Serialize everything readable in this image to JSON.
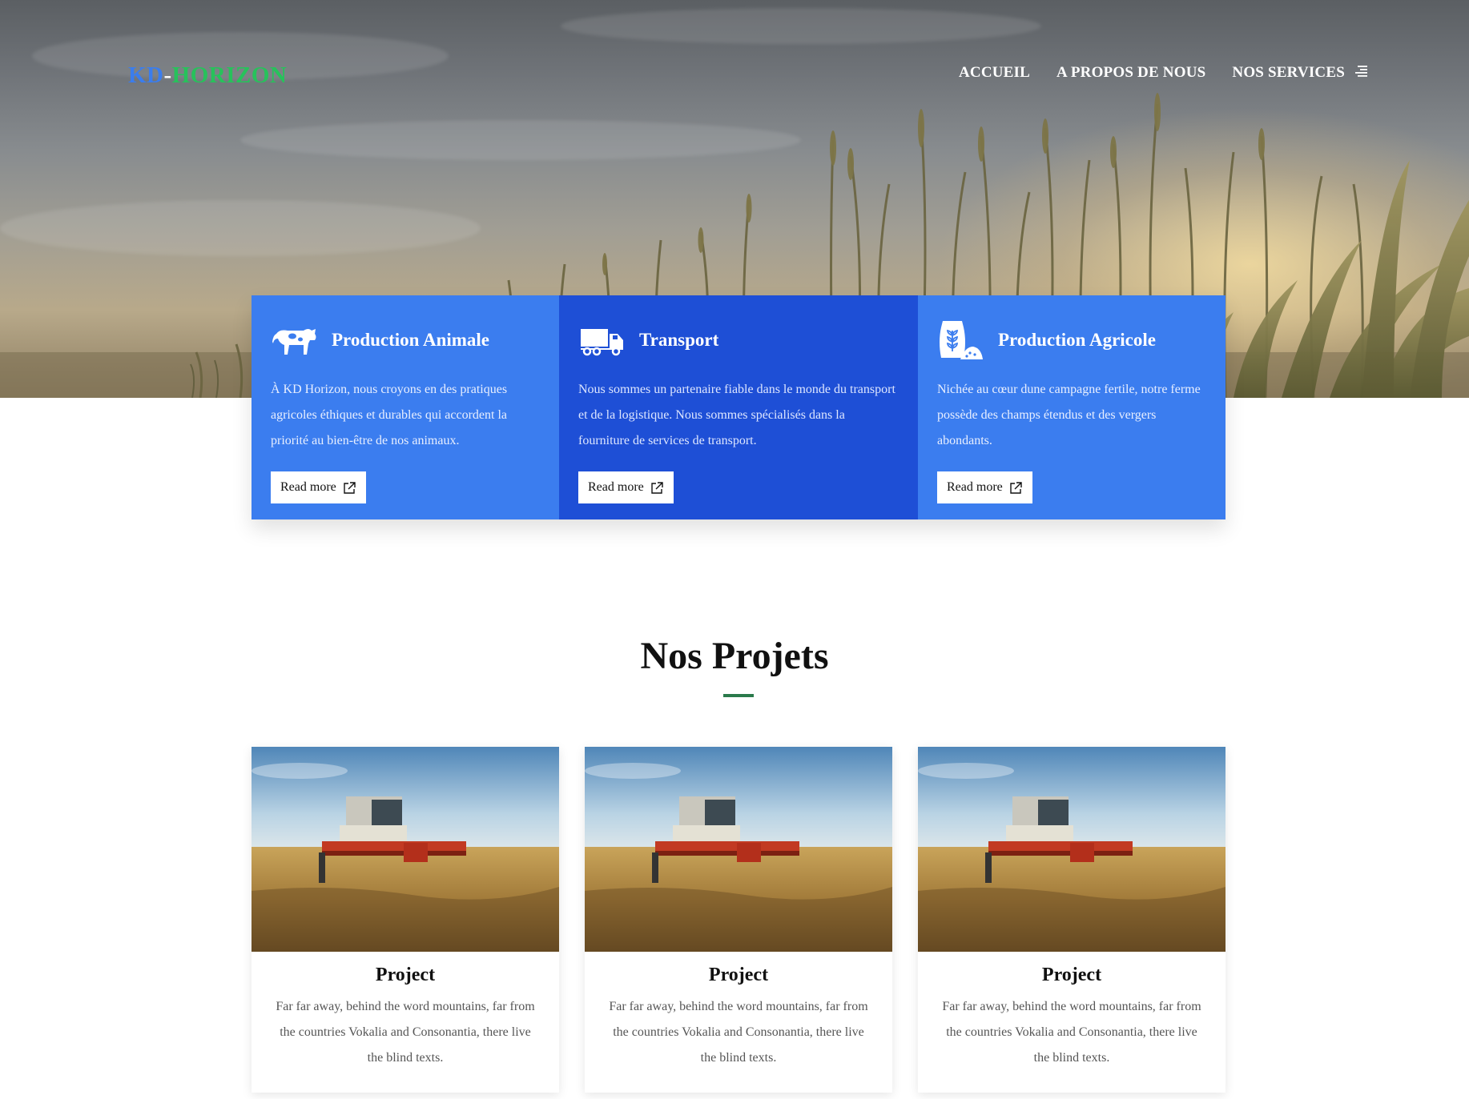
{
  "brand": {
    "part1": "KD",
    "sep": "-",
    "part2": "HORIZON",
    "color1": "#3b7ded",
    "color2": "#27c25b"
  },
  "nav": {
    "items": [
      {
        "label": "ACCUEIL"
      },
      {
        "label": "A PROPOS DE NOUS"
      },
      {
        "label": "NOS SERVICES"
      }
    ],
    "menu_icon": "menu-icon"
  },
  "services": [
    {
      "icon": "cow-icon",
      "title": "Production Animale",
      "text": "À KD Horizon, nous croyons en des pratiques agricoles éthiques et durables qui accordent la priorité au bien-être de nos animaux.",
      "button": "Read more"
    },
    {
      "icon": "truck-icon",
      "title": "Transport",
      "text": "Nous sommes un partenaire fiable dans le monde du transport et de la logistique. Nous sommes spécialisés dans la fourniture de services de transport.",
      "button": "Read more"
    },
    {
      "icon": "grain-sack-icon",
      "title": "Production Agricole",
      "text": "Nichée au cœur dune campagne fertile, notre ferme possède des champs étendus et des vergers abondants.",
      "button": "Read more"
    }
  ],
  "projects_section": {
    "title": "Nos Projets",
    "accent": "#2a7a4b"
  },
  "projects": [
    {
      "title": "Project",
      "text": "Far far away, behind the word mountains, far from the countries Vokalia and Consonantia, there live the blind texts."
    },
    {
      "title": "Project",
      "text": "Far far away, behind the word mountains, far from the countries Vokalia and Consonantia, there live the blind texts."
    },
    {
      "title": "Project",
      "text": "Far far away, behind the word mountains, far from the countries Vokalia and Consonantia, there live the blind texts."
    }
  ],
  "colors": {
    "service_blue": "#3b7def",
    "service_dark_blue": "#1e4fd6"
  }
}
